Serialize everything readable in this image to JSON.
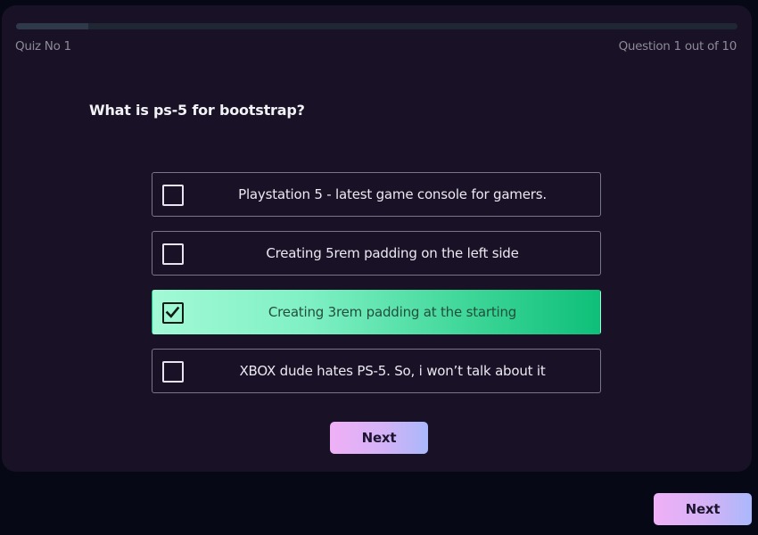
{
  "header": {
    "quiz_label": "Quiz No 1",
    "question_count": "Question 1 out of 10",
    "progress_fraction": 0.1
  },
  "question": "What is ps-5 for bootstrap?",
  "options": [
    {
      "label": "Playstation 5 - latest game console for gamers.",
      "selected": false
    },
    {
      "label": "Creating 5rem padding on the left side",
      "selected": false
    },
    {
      "label": "Creating 3rem padding at the starting",
      "selected": true
    },
    {
      "label": "XBOX dude hates PS-5. So, i won’t talk about it",
      "selected": false
    }
  ],
  "buttons": {
    "next_inner": "Next",
    "next_outer": "Next"
  },
  "colors": {
    "background": "#070815",
    "card": "#191226",
    "selected_gradient": [
      "#a2f9d6",
      "#0ebf79"
    ],
    "button_gradient": [
      "#f0b0f6",
      "#a9b8fb"
    ]
  }
}
